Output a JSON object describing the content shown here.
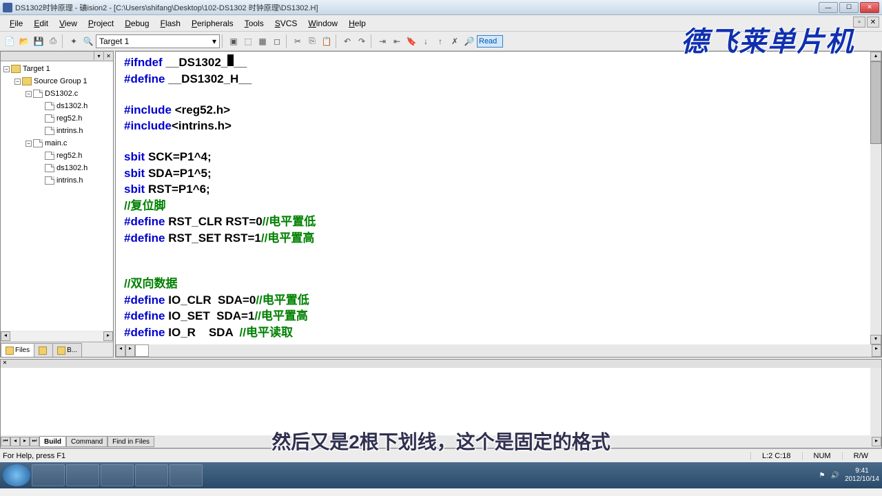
{
  "title": "DS1302时钟原理 - 礦ision2 - [C:\\Users\\shifang\\Desktop\\102-DS1302 时钟原理\\DS1302.H]",
  "menu": [
    "File",
    "Edit",
    "View",
    "Project",
    "Debug",
    "Flash",
    "Peripherals",
    "Tools",
    "SVCS",
    "Window",
    "Help"
  ],
  "target": "Target 1",
  "find_text": "Read",
  "tree": {
    "root": "Target 1",
    "group": "Source Group 1",
    "files": [
      {
        "name": "DS1302.c",
        "children": [
          "ds1302.h",
          "reg52.h",
          "intrins.h"
        ]
      },
      {
        "name": "main.c",
        "children": [
          "reg52.h",
          "ds1302.h",
          "intrins.h"
        ]
      }
    ]
  },
  "pane_tabs": [
    "Files",
    "",
    "B..."
  ],
  "code": {
    "l1a": "#ifndef",
    "l1b": " __DS1302_",
    "l1c": "__",
    "l2a": "#define",
    "l2b": " __DS1302_H__",
    "l3a": "#include",
    "l3b": " <reg52.h>",
    "l4a": "#include",
    "l4b": "<intrins.h>",
    "l5a": "sbit",
    "l5b": " SCK=P1^4;",
    "l6a": "sbit",
    "l6b": " SDA=P1^5;",
    "l7a": "sbit",
    "l7b": " RST=P1^6;",
    "l8": "//复位脚",
    "l9a": "#define",
    "l9b": " RST_CLR RST=0",
    "l9c": "//电平置低",
    "l10a": "#define",
    "l10b": " RST_SET RST=1",
    "l10c": "//电平置高",
    "l11": "//双向数据",
    "l12a": "#define",
    "l12b": " IO_CLR  SDA=0",
    "l12c": "//电平置低",
    "l13a": "#define",
    "l13b": " IO_SET  SDA=1",
    "l13c": "//电平置高",
    "l14a": "#define",
    "l14b": " IO_R    SDA  ",
    "l14c": "//电平读取"
  },
  "output_tabs": [
    "Build",
    "Command",
    "Find in Files"
  ],
  "status": {
    "help": "For Help, press F1",
    "pos": "L:2 C:18",
    "num": "NUM",
    "rw": "R/W"
  },
  "tray": {
    "time": "9:41",
    "date": "2012/10/14"
  },
  "watermark": "德飞莱单片机",
  "subtitle": "然后又是2根下划线，这个是固定的格式"
}
